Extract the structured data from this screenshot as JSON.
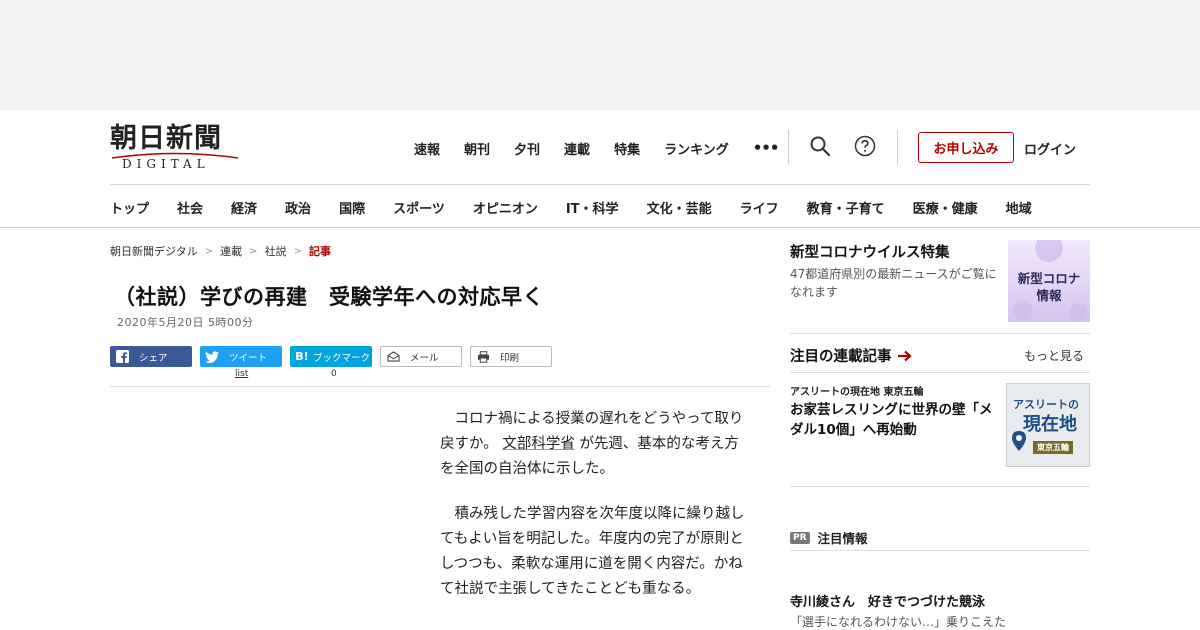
{
  "header": {
    "logo_jp": "朝日新聞",
    "logo_en": "DIGITAL",
    "global_nav": [
      "速報",
      "朝刊",
      "夕刊",
      "連載",
      "特集",
      "ランキング"
    ],
    "more_label": "•••",
    "subscribe_label": "お申し込み",
    "login_label": "ログイン"
  },
  "category_nav": [
    "トップ",
    "社会",
    "経済",
    "政治",
    "国際",
    "スポーツ",
    "オピニオン",
    "IT・科学",
    "文化・芸能",
    "ライフ",
    "教育・子育て",
    "医療・健康",
    "地域"
  ],
  "breadcrumb": [
    "朝日新聞デジタル",
    "連載",
    "社説",
    "記事"
  ],
  "breadcrumb_sep": ">",
  "article": {
    "title": "（社説）学びの再建　受験学年への対応早く",
    "date": "2020年5月20日 5時00分",
    "share": {
      "facebook": "シェア",
      "twitter": "ツイート",
      "hatena": "ブックマーク",
      "hatena_icon": "B!",
      "mail": "メール",
      "print": "印刷",
      "twitter_count": "list",
      "hatena_count": "0"
    },
    "para1_before": "　コロナ禍による授業の遅れをどうやって取り戻すか。",
    "para1_link": "文部科学省",
    "para1_after": "が先週、基本的な考え方を全国の自治体に示した。",
    "para2": "　積み残した学習内容を次年度以降に繰り越してもよい旨を明記した。年度内の完了が原則としつつも、柔軟な運用に道を開く内容だ。かねて社説で主張してきたことども重なる。"
  },
  "sidebar": {
    "promo": {
      "title": "新型コロナウイルス特集",
      "sub": "47都道府県別の最新ニュースがご覧になれます",
      "img_line1": "新型コロナ",
      "img_line2": "情報"
    },
    "series": {
      "title": "注目の連載記事",
      "more": "もっと見る",
      "kicker": "アスリートの現在地 東京五輪",
      "headline": "お家芸レスリングに世界の壁「メダル10個」へ再始動",
      "img_line1": "アスリートの",
      "img_line2": "現在地",
      "img_badge": "東京五輪"
    },
    "pr": {
      "badge": "PR",
      "label": "注目情報",
      "headline": "寺川綾さん　好きでつづけた競泳",
      "sub": "「選手になれるわけない…」乗りこえた"
    }
  },
  "colors": {
    "brand_red": "#b40000",
    "facebook": "#3b5998",
    "twitter": "#1da1f2",
    "hatena": "#00a4de"
  },
  "icons": [
    "search-icon",
    "help-icon",
    "facebook-icon",
    "twitter-icon",
    "hatena-icon",
    "mail-icon",
    "print-icon",
    "arrow-right-icon"
  ]
}
